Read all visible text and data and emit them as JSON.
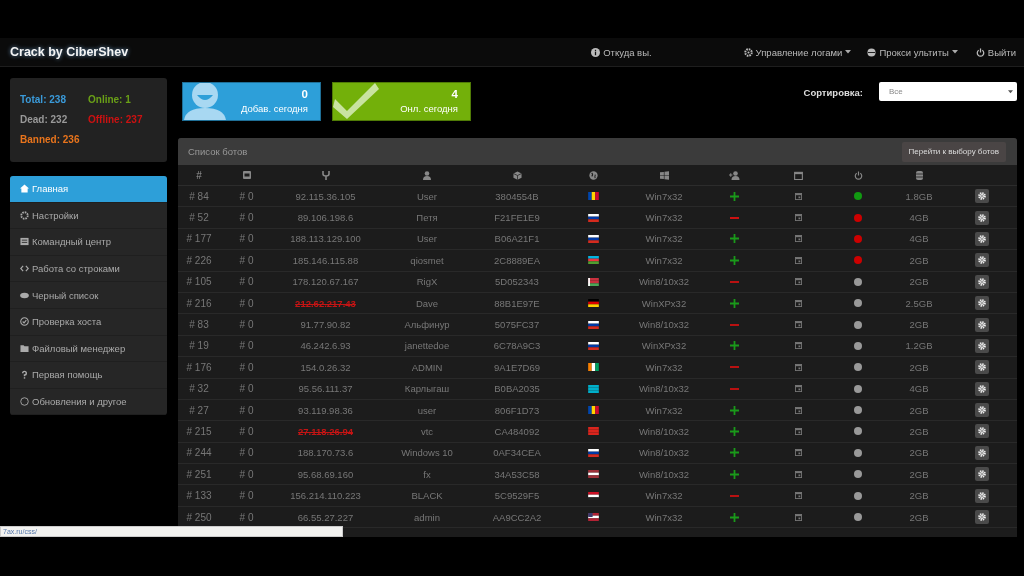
{
  "navbar": {
    "brand": "Crack by CiberShev",
    "items": [
      {
        "label": "Откуда вы.",
        "dropdown": false
      },
      {
        "label": "Управление логами",
        "dropdown": true
      },
      {
        "label": "Прокси ультиты",
        "dropdown": true
      },
      {
        "label": "Выйти",
        "dropdown": false
      }
    ]
  },
  "stats": [
    {
      "label": "Total: 238",
      "color": "#3a9ad9"
    },
    {
      "label": "Online: 1",
      "color": "#6aa017"
    },
    {
      "label": "Dead: 232",
      "color": "#999999"
    },
    {
      "label": "Offline: 237",
      "color": "#cc1111"
    },
    {
      "label": "Banned: 236",
      "color": "#e8741c"
    }
  ],
  "sidebar": {
    "items": [
      {
        "label": "Главная",
        "selected": true
      },
      {
        "label": "Настройки",
        "selected": false
      },
      {
        "label": "Командный центр",
        "selected": false
      },
      {
        "label": "Работа со строками",
        "selected": false
      },
      {
        "label": "Черный список",
        "selected": false
      },
      {
        "label": "Проверка хоста",
        "selected": false
      },
      {
        "label": "Файловый менеджер",
        "selected": false
      },
      {
        "label": "Первая помощь",
        "selected": false
      },
      {
        "label": "Обновления и другое",
        "selected": false
      }
    ]
  },
  "cards": [
    {
      "kind": "added",
      "value": "0",
      "label": "Добав. сегодня"
    },
    {
      "kind": "online",
      "value": "4",
      "label": "Онл. сегодня"
    }
  ],
  "sort": {
    "label": "Сортировка:",
    "value": "Все"
  },
  "panel": {
    "title": "Список ботов",
    "button": "Перейти к выбору ботов"
  },
  "table": {
    "first_header": "#",
    "rows": [
      {
        "id": "# 84",
        "num": "# 0",
        "ip": "92.115.36.105",
        "ip_blocked": false,
        "user": "User",
        "hwid": "3804554B",
        "kind": "md",
        "os": "Win7x32",
        "admin": true,
        "color": "#119911",
        "ram": "1.8GB"
      },
      {
        "id": "# 52",
        "num": "# 0",
        "ip": "89.106.198.6",
        "ip_blocked": false,
        "user": "Петя",
        "hwid": "F21FE1E9",
        "kind": "ru",
        "os": "Win7x32",
        "admin": false,
        "color": "#cc0000",
        "ram": "4GB"
      },
      {
        "id": "# 177",
        "num": "# 0",
        "ip": "188.113.129.100",
        "ip_blocked": false,
        "user": "User",
        "hwid": "B06A21F1",
        "kind": "ru",
        "os": "Win7x32",
        "admin": true,
        "color": "#cc0000",
        "ram": "4GB"
      },
      {
        "id": "# 226",
        "num": "# 0",
        "ip": "185.146.115.88",
        "ip_blocked": false,
        "user": "qiosmet",
        "hwid": "2C8889EA",
        "kind": "az",
        "os": "Win7x32",
        "admin": true,
        "color": "#cc0000",
        "ram": "2GB"
      },
      {
        "id": "# 105",
        "num": "# 0",
        "ip": "178.120.67.167",
        "ip_blocked": false,
        "user": "RigX",
        "hwid": "5D052343",
        "kind": "by",
        "os": "Win8/10x32",
        "admin": false,
        "color": "#999999",
        "ram": "2GB"
      },
      {
        "id": "# 216",
        "num": "# 0",
        "ip": "212.62.217.43",
        "ip_blocked": true,
        "user": "Dave",
        "hwid": "88B1E97E",
        "kind": "de",
        "os": "WinXPx32",
        "admin": true,
        "color": "#999999",
        "ram": "2.5GB"
      },
      {
        "id": "# 83",
        "num": "# 0",
        "ip": "91.77.90.82",
        "ip_blocked": false,
        "user": "Альфинур",
        "hwid": "5075FC37",
        "kind": "ru",
        "os": "Win8/10x32",
        "admin": false,
        "color": "#999999",
        "ram": "2GB"
      },
      {
        "id": "# 19",
        "num": "# 0",
        "ip": "46.242.6.93",
        "ip_blocked": false,
        "user": "janettedoe",
        "hwid": "6C78A9C3",
        "kind": "ru",
        "os": "WinXPx32",
        "admin": true,
        "color": "#999999",
        "ram": "1.2GB"
      },
      {
        "id": "# 176",
        "num": "# 0",
        "ip": "154.0.26.32",
        "ip_blocked": false,
        "user": "ADMIN",
        "hwid": "9A1E7D69",
        "kind": "ci",
        "os": "Win7x32",
        "admin": false,
        "color": "#999999",
        "ram": "2GB"
      },
      {
        "id": "# 32",
        "num": "# 0",
        "ip": "95.56.111.37",
        "ip_blocked": false,
        "user": "Карлыгаш",
        "hwid": "B0BA2035",
        "kind": "kz",
        "os": "Win8/10x32",
        "admin": false,
        "color": "#999999",
        "ram": "4GB"
      },
      {
        "id": "# 27",
        "num": "# 0",
        "ip": "93.119.98.36",
        "ip_blocked": false,
        "user": "user",
        "hwid": "806F1D73",
        "kind": "md",
        "os": "Win7x32",
        "admin": true,
        "color": "#999999",
        "ram": "2GB"
      },
      {
        "id": "# 215",
        "num": "# 0",
        "ip": "27.118.26.94",
        "ip_blocked": true,
        "user": "vtc",
        "hwid": "CA484092",
        "kind": "vn",
        "os": "Win8/10x32",
        "admin": true,
        "color": "#999999",
        "ram": "2GB"
      },
      {
        "id": "# 244",
        "num": "# 0",
        "ip": "188.170.73.6",
        "ip_blocked": false,
        "user": "Windows 10",
        "hwid": "0AF34CEA",
        "kind": "ru",
        "os": "Win8/10x32",
        "admin": true,
        "color": "#999999",
        "ram": "2GB"
      },
      {
        "id": "# 251",
        "num": "# 0",
        "ip": "95.68.69.160",
        "ip_blocked": false,
        "user": "fx",
        "hwid": "34A53C58",
        "kind": "lv",
        "os": "Win8/10x32",
        "admin": true,
        "color": "#999999",
        "ram": "2GB"
      },
      {
        "id": "# 133",
        "num": "# 0",
        "ip": "156.214.110.223",
        "ip_blocked": false,
        "user": "BLACK",
        "hwid": "5C9529F5",
        "kind": "eg",
        "os": "Win7x32",
        "admin": false,
        "color": "#999999",
        "ram": "2GB"
      },
      {
        "id": "# 250",
        "num": "# 0",
        "ip": "66.55.27.227",
        "ip_blocked": false,
        "user": "admin",
        "hwid": "AA9CC2A2",
        "kind": "us",
        "os": "Win7x32",
        "admin": true,
        "color": "#999999",
        "ram": "2GB"
      }
    ]
  },
  "status_bar": {
    "url": "7ax.ru/css/"
  }
}
